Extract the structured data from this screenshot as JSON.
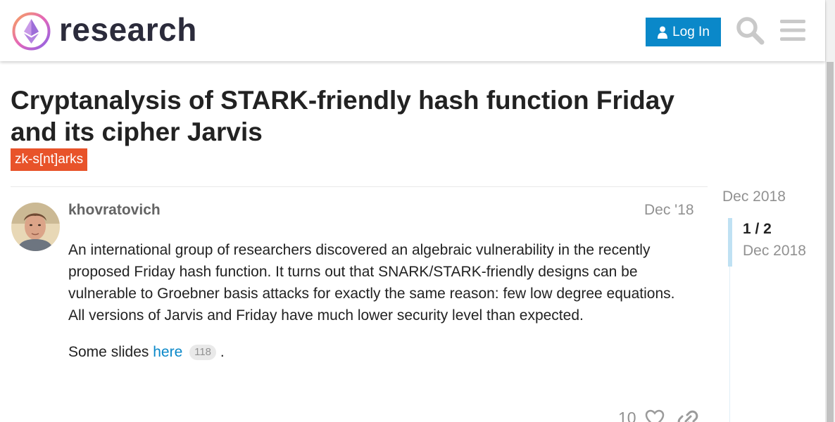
{
  "header": {
    "brand": "research",
    "login_label": "Log In"
  },
  "topic": {
    "title": "Cryptanalysis of STARK-friendly hash function Friday and its cipher Jarvis",
    "tag": "zk-s[nt]arks"
  },
  "post": {
    "username": "khovratovich",
    "date": "Dec '18",
    "paragraph1": "An international group of researchers discovered an algebraic vulnerability in the recently proposed Friday hash function. It turns out that SNARK/STARK-friendly designs can be vulnerable to Groebner basis attacks for exactly the same reason: few low degree equations. All versions of Jarvis and Friday have much lower security level than expected.",
    "paragraph2_prefix": "Some slides ",
    "link_text": "here",
    "link_clicks": "118",
    "paragraph2_suffix": " .",
    "like_count": "10"
  },
  "timeline": {
    "start_date": "Dec 2018",
    "position": "1 / 2",
    "current_date": "Dec 2018"
  },
  "colors": {
    "accent": "#0a88c9",
    "tag": "#e8532a"
  },
  "icons": [
    "user-icon",
    "search-icon",
    "hamburger-menu-icon",
    "heart-icon",
    "link-icon"
  ]
}
